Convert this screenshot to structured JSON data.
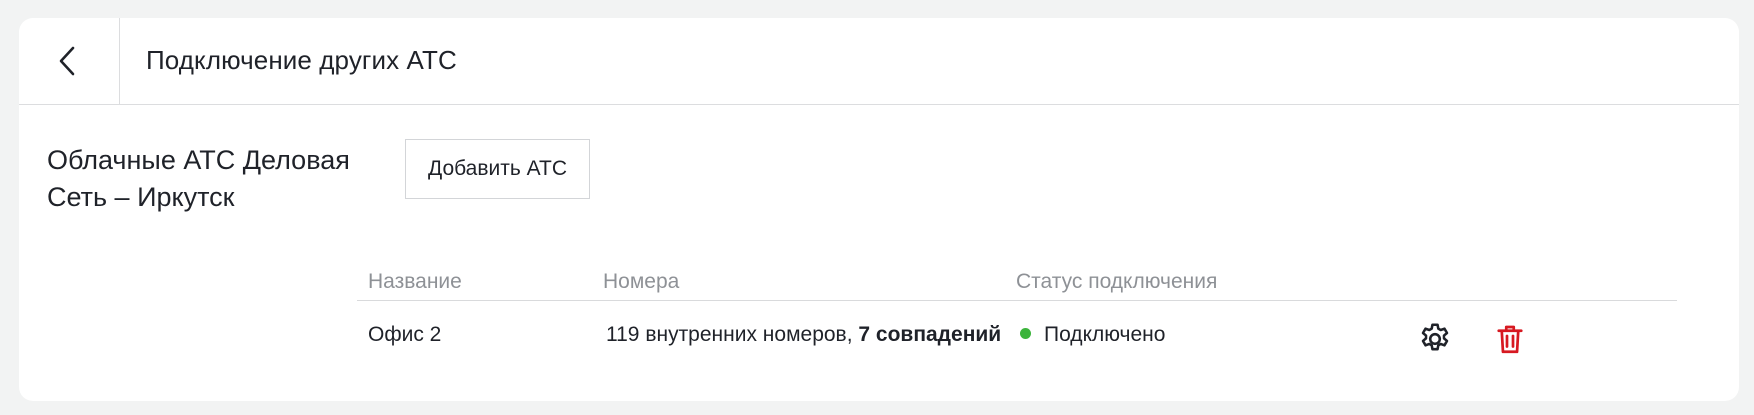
{
  "header": {
    "back_icon": "chevron-left-icon",
    "title": "Подключение других АТС"
  },
  "section": {
    "title": "Облачные АТС Деловая Сеть – Иркутск",
    "add_button_label": "Добавить АТС"
  },
  "table": {
    "columns": [
      "Название",
      "Номера",
      "Статус подключения"
    ],
    "rows": [
      {
        "name": "Офис 2",
        "numbers_text": "119 внутренних номеров,",
        "matches_text": "7 совпадений",
        "status": "Подключено",
        "status_color": "#3cb43c",
        "actions": [
          "gear-icon",
          "trash-icon"
        ]
      }
    ]
  },
  "colors": {
    "background": "#f2f3f3",
    "card": "#ffffff",
    "delete_icon": "#d71921",
    "muted_text": "#8e9196"
  }
}
